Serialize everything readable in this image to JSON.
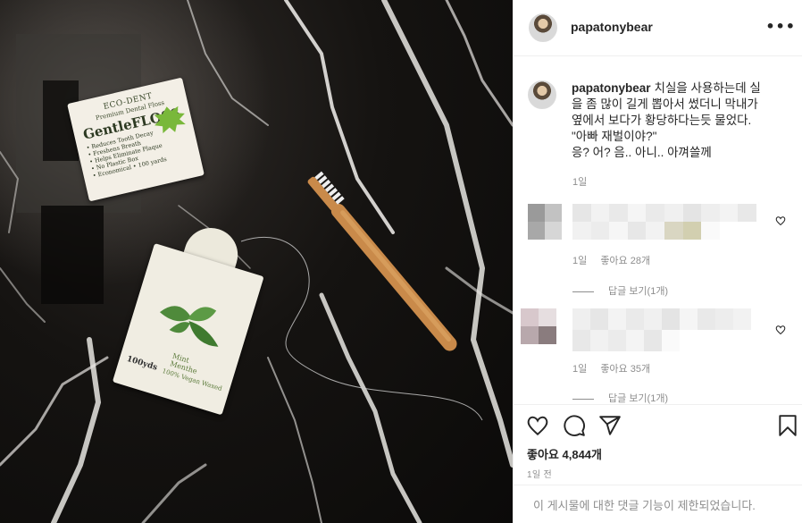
{
  "post": {
    "username": "papatonybear",
    "more_icon": "ellipsis-icon",
    "caption_username": "papatonybear",
    "caption_text": "치실을 사용하는데 실\n을 좀 많이 길게 뽑아서 썼더니 막내가\n옆에서 보다가 황당하다는듯 물었다.\n\"아빠 재벌이야?\"\n응? 어? 음.. 아니.. 아껴쓸께",
    "caption_time": "1일"
  },
  "photo": {
    "floss_card": {
      "brand": "ECO-DENT",
      "subtitle": "Premium Dental Floss",
      "name": "GentleFLOSS",
      "bullets": [
        "Reduces Tooth Decay",
        "Freshens Breath",
        "Helps Eliminate Plaque",
        "No Plastic Box",
        "Economical • 100 yards"
      ]
    },
    "mint_box": {
      "flavor": "Mint\nMenthe",
      "length": "100yds",
      "vegan": "100% Vegan Waxed"
    }
  },
  "comments": [
    {
      "time": "1일",
      "likes": "좋아요 28개",
      "replies": "답글 보기(1개)"
    },
    {
      "time": "1일",
      "likes": "좋아요 35개",
      "replies": "답글 보기(1개)"
    }
  ],
  "actions": {
    "like_icon": "heart-icon",
    "comment_icon": "comment-icon",
    "share_icon": "share-icon",
    "save_icon": "bookmark-icon",
    "likes": "좋아요 4,844개",
    "posted": "1일 전"
  },
  "footer": {
    "comments_disabled": "이 게시물에 대한 댓글 기능이 제한되었습니다."
  }
}
